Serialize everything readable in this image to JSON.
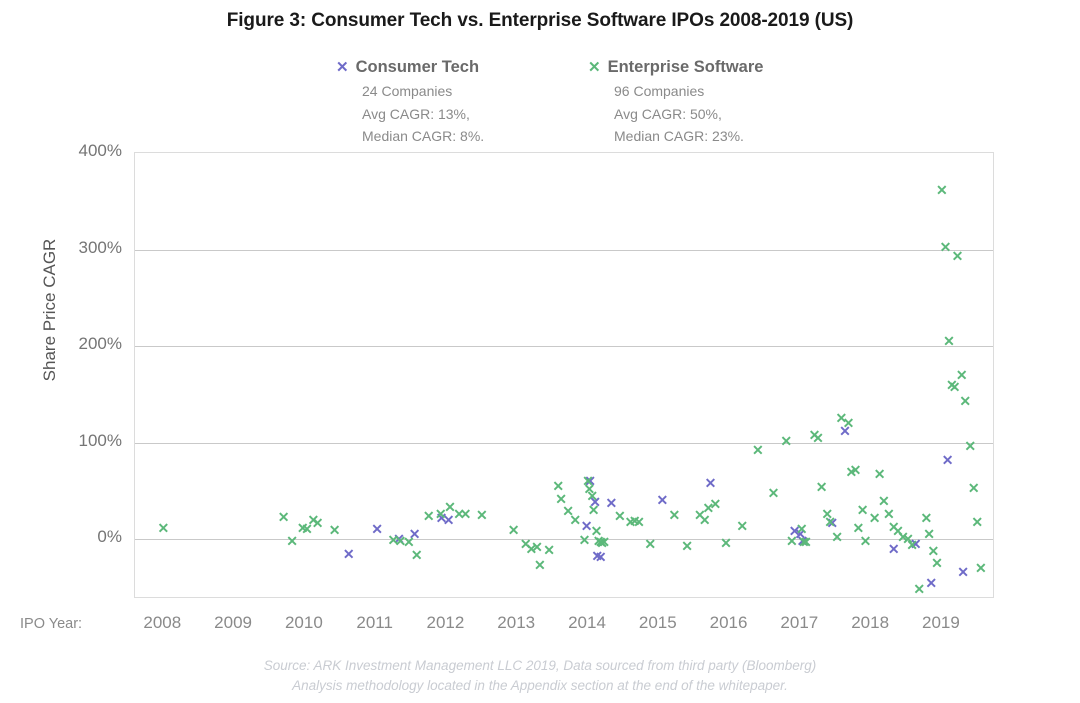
{
  "title": "Figure 3: Consumer Tech vs. Enterprise Software IPOs 2008-2019 (US)",
  "legend": {
    "consumer": {
      "marker": "✕",
      "name": "Consumer Tech",
      "companies": "24 Companies",
      "avg": "Avg CAGR: 13%,",
      "median": "Median CAGR: 8%.",
      "color": "#6f6bc8"
    },
    "enterprise": {
      "marker": "✕",
      "name": "Enterprise Software",
      "companies": "96 Companies",
      "avg": "Avg CAGR: 50%,",
      "median": "Median CAGR: 23%.",
      "color": "#5cb87a"
    }
  },
  "axes": {
    "y_title": "Share Price CAGR",
    "x_title": "IPO Year:"
  },
  "source": {
    "line1": "Source: ARK Investment Management LLC 2019, Data sourced from third party (Bloomberg)",
    "line2": "Analysis methodology located in the Appendix section at the end of the whitepaper."
  },
  "chart_data": {
    "type": "scatter",
    "title": "Figure 3: Consumer Tech vs. Enterprise Software IPOs 2008-2019 (US)",
    "xlabel": "IPO Year:",
    "ylabel": "Share Price CAGR",
    "xlim": [
      2007.6,
      2019.75
    ],
    "ylim": [
      -0.62,
      4.0
    ],
    "ytick_labels": [
      "400%",
      "300%",
      "200%",
      "100%",
      "0%"
    ],
    "ytick_values": [
      4.0,
      3.0,
      2.0,
      1.0,
      0.0
    ],
    "xtick_labels": [
      "2008",
      "2009",
      "2010",
      "2011",
      "2012",
      "2013",
      "2014",
      "2015",
      "2016",
      "2017",
      "2018",
      "2019"
    ],
    "xtick_values": [
      2008,
      2009,
      2010,
      2011,
      2012,
      2013,
      2014,
      2015,
      2016,
      2017,
      2018,
      2019
    ],
    "grid": "horizontal",
    "legend_position": "top-center",
    "series": [
      {
        "name": "Consumer Tech",
        "color": "#6f6bc8",
        "marker": "x",
        "count": 24,
        "avg_cagr": 0.13,
        "median_cagr": 0.08,
        "points": [
          [
            2010.62,
            -0.15
          ],
          [
            2011.02,
            0.11
          ],
          [
            2011.33,
            0.0
          ],
          [
            2011.55,
            0.05
          ],
          [
            2011.93,
            0.22
          ],
          [
            2012.03,
            0.2
          ],
          [
            2013.98,
            0.14
          ],
          [
            2014.03,
            0.6
          ],
          [
            2014.1,
            0.38
          ],
          [
            2014.13,
            -0.17
          ],
          [
            2014.18,
            -0.18
          ],
          [
            2014.33,
            0.37
          ],
          [
            2015.05,
            0.41
          ],
          [
            2015.73,
            0.58
          ],
          [
            2016.92,
            0.08
          ],
          [
            2017.0,
            0.05
          ],
          [
            2017.03,
            -0.02
          ],
          [
            2017.45,
            0.17
          ],
          [
            2017.63,
            1.12
          ],
          [
            2018.32,
            -0.1
          ],
          [
            2018.63,
            -0.05
          ],
          [
            2018.85,
            -0.45
          ],
          [
            2019.08,
            0.82
          ],
          [
            2019.3,
            -0.34
          ]
        ]
      },
      {
        "name": "Enterprise Software",
        "color": "#5cb87a",
        "marker": "x",
        "count": 96,
        "avg_cagr": 0.5,
        "median_cagr": 0.23,
        "points": [
          [
            2008.0,
            0.12
          ],
          [
            2009.7,
            0.23
          ],
          [
            2009.82,
            -0.02
          ],
          [
            2009.97,
            0.12
          ],
          [
            2010.03,
            0.1
          ],
          [
            2010.12,
            0.2
          ],
          [
            2010.18,
            0.17
          ],
          [
            2010.42,
            0.09
          ],
          [
            2011.25,
            -0.01
          ],
          [
            2011.35,
            -0.02
          ],
          [
            2011.47,
            -0.03
          ],
          [
            2011.58,
            -0.16
          ],
          [
            2011.75,
            0.24
          ],
          [
            2011.92,
            0.26
          ],
          [
            2012.05,
            0.33
          ],
          [
            2012.18,
            0.26
          ],
          [
            2012.27,
            0.26
          ],
          [
            2012.5,
            0.25
          ],
          [
            2012.95,
            0.09
          ],
          [
            2013.12,
            -0.05
          ],
          [
            2013.2,
            -0.1
          ],
          [
            2013.28,
            -0.08
          ],
          [
            2013.32,
            -0.27
          ],
          [
            2013.45,
            -0.11
          ],
          [
            2013.58,
            0.55
          ],
          [
            2013.62,
            0.42
          ],
          [
            2013.72,
            0.29
          ],
          [
            2013.82,
            0.2
          ],
          [
            2013.95,
            -0.01
          ],
          [
            2014.0,
            0.6
          ],
          [
            2014.02,
            0.52
          ],
          [
            2014.06,
            0.45
          ],
          [
            2014.08,
            0.3
          ],
          [
            2014.12,
            0.08
          ],
          [
            2014.15,
            -0.02
          ],
          [
            2014.18,
            -0.03
          ],
          [
            2014.2,
            -0.04
          ],
          [
            2014.23,
            -0.03
          ],
          [
            2014.45,
            0.24
          ],
          [
            2014.6,
            0.18
          ],
          [
            2014.66,
            0.19
          ],
          [
            2014.72,
            0.18
          ],
          [
            2014.88,
            -0.05
          ],
          [
            2015.22,
            0.25
          ],
          [
            2015.4,
            -0.07
          ],
          [
            2015.58,
            0.25
          ],
          [
            2015.65,
            0.2
          ],
          [
            2015.7,
            0.32
          ],
          [
            2015.8,
            0.36
          ],
          [
            2015.95,
            -0.04
          ],
          [
            2016.18,
            0.14
          ],
          [
            2016.4,
            0.92
          ],
          [
            2016.62,
            0.48
          ],
          [
            2016.8,
            1.02
          ],
          [
            2016.88,
            -0.02
          ],
          [
            2017.02,
            0.1
          ],
          [
            2017.05,
            -0.03
          ],
          [
            2017.08,
            -0.03
          ],
          [
            2017.2,
            1.08
          ],
          [
            2017.25,
            1.05
          ],
          [
            2017.3,
            0.54
          ],
          [
            2017.38,
            0.26
          ],
          [
            2017.42,
            0.18
          ],
          [
            2017.52,
            0.02
          ],
          [
            2017.58,
            1.25
          ],
          [
            2017.68,
            1.2
          ],
          [
            2017.72,
            0.7
          ],
          [
            2017.78,
            0.72
          ],
          [
            2017.82,
            0.12
          ],
          [
            2017.88,
            0.3
          ],
          [
            2017.92,
            -0.02
          ],
          [
            2018.05,
            0.22
          ],
          [
            2018.12,
            0.68
          ],
          [
            2018.18,
            0.4
          ],
          [
            2018.25,
            0.26
          ],
          [
            2018.32,
            0.13
          ],
          [
            2018.38,
            0.08
          ],
          [
            2018.45,
            0.02
          ],
          [
            2018.52,
            0.0
          ],
          [
            2018.58,
            -0.06
          ],
          [
            2018.68,
            -0.52
          ],
          [
            2018.78,
            0.22
          ],
          [
            2018.82,
            0.05
          ],
          [
            2018.88,
            -0.12
          ],
          [
            2018.93,
            -0.25
          ],
          [
            2019.0,
            3.62
          ],
          [
            2019.05,
            3.03
          ],
          [
            2019.1,
            2.05
          ],
          [
            2019.14,
            1.6
          ],
          [
            2019.18,
            1.58
          ],
          [
            2019.22,
            2.93
          ],
          [
            2019.28,
            1.7
          ],
          [
            2019.33,
            1.43
          ],
          [
            2019.4,
            0.96
          ],
          [
            2019.45,
            0.53
          ],
          [
            2019.5,
            0.18
          ],
          [
            2019.55,
            -0.3
          ]
        ]
      }
    ]
  }
}
